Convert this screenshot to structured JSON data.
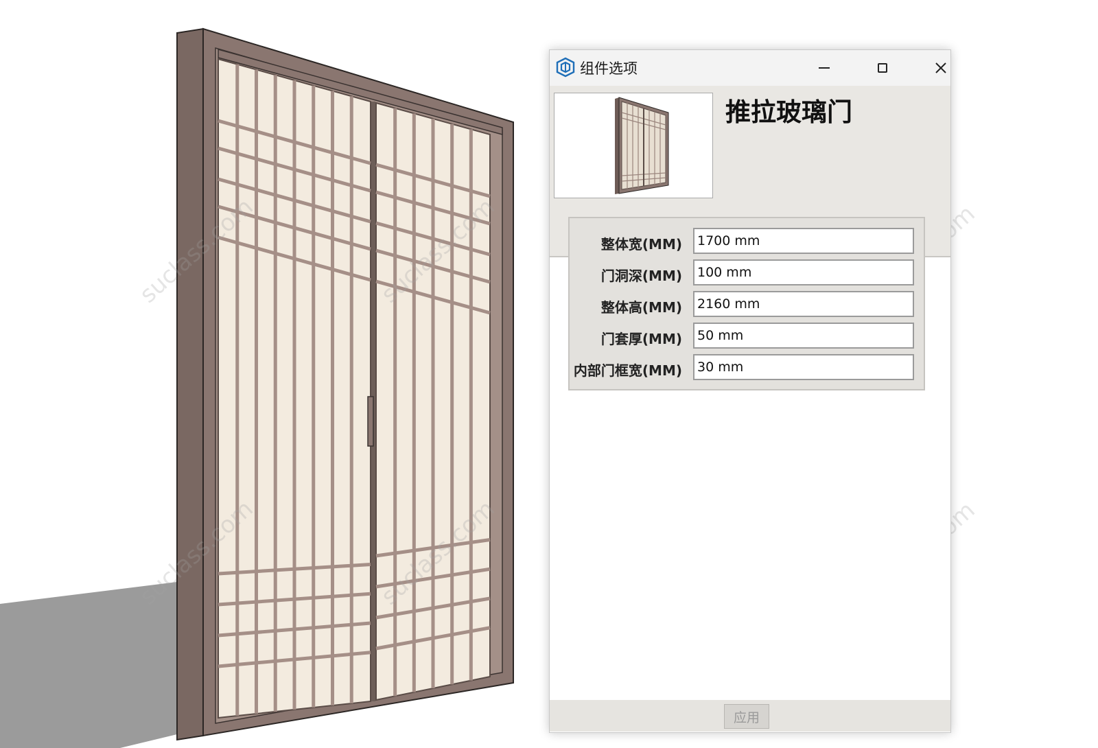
{
  "dialog": {
    "title": "组件选项",
    "component_name": "推拉玻璃门",
    "parameters": [
      {
        "label": "整体宽(MM)",
        "value": "1700 mm"
      },
      {
        "label": "门洞深(MM)",
        "value": "100 mm"
      },
      {
        "label": "整体高(MM)",
        "value": "2160 mm"
      },
      {
        "label": "门套厚(MM)",
        "value": "50 mm"
      },
      {
        "label": "内部门框宽(MM)",
        "value": "30 mm"
      }
    ],
    "apply_label": "应用"
  },
  "watermark": "suclass.com",
  "colors": {
    "frame": "#8a7670",
    "glass": "#f3ebdf",
    "shadow": "#9a9a9a",
    "panel_bg": "#e3e1dd",
    "header_bg": "#e9e7e3"
  },
  "icons": {
    "app": "sketchup-logo-icon",
    "minimize": "minimize-icon",
    "maximize": "maximize-icon",
    "close": "close-icon"
  }
}
